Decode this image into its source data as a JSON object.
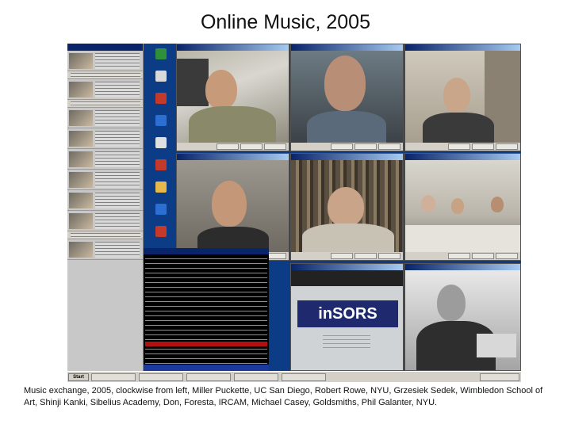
{
  "slide": {
    "title": "Online Music, 2005",
    "caption": "Music exchange, 2005, clockwise from left, Miller Puckette, UC San Diego, Robert Rowe, NYU, Grzesiek Sedek, Wimbledon School of Art, Shinji Kanki, Sibelius Academy, Don, Foresta, IRCAM, Michael Casey, Goldsmiths, Phil Galanter, NYU."
  },
  "screenshot": {
    "start_label": "Start",
    "participant_rows": 11,
    "video_windows": [
      {
        "id": "top-left"
      },
      {
        "id": "top-middle"
      },
      {
        "id": "top-right"
      },
      {
        "id": "middle-left"
      },
      {
        "id": "middle-middle"
      },
      {
        "id": "middle-right"
      },
      {
        "id": "bottom-middle",
        "logo": "inSORS"
      },
      {
        "id": "bottom-right"
      }
    ]
  },
  "colors": {
    "desktop": "#0c3c86",
    "titlebar": "#0a246a",
    "window_chrome": "#d4d0c8",
    "terminal_bg": "#000000",
    "insors_blue": "#1f2a6e"
  }
}
